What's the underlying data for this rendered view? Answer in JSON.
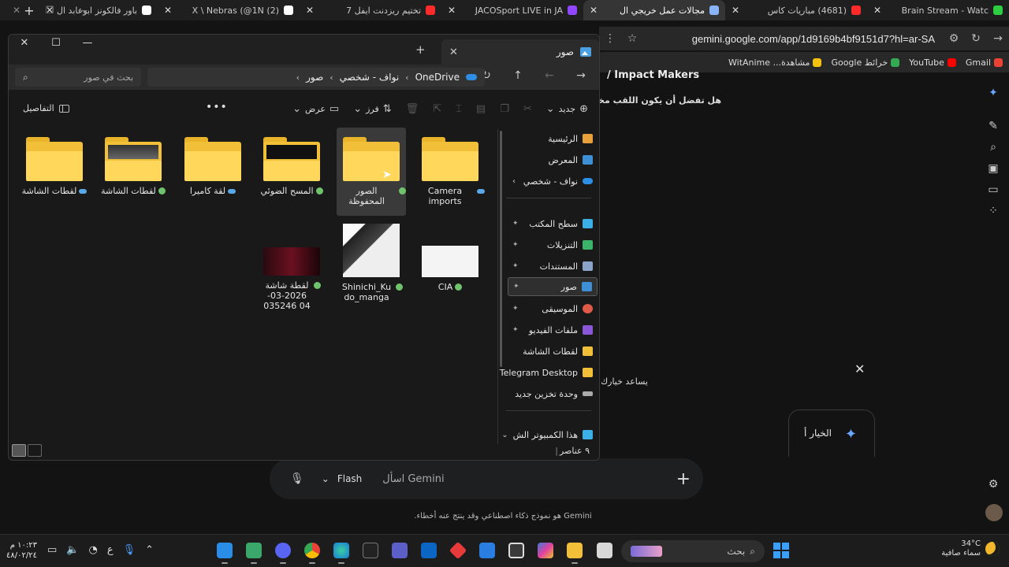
{
  "browser": {
    "tabs": [
      {
        "label": "Brain Stream - Watc",
        "icon_color": "#2ecc40"
      },
      {
        "label": "(4681) مباريات كاس",
        "icon_color": "#ff2b2b"
      },
      {
        "label": "مجالات عمل خريجي ال",
        "icon_color": "#8ab4f8",
        "active": true
      },
      {
        "label": "JACOSport LIVE in JA",
        "icon_color": "#9146ff"
      },
      {
        "label": "تختيم ريزدنت ايفل 7",
        "icon_color": "#ff2b2b"
      },
      {
        "label": "(2) X \\ Nebras (@1N",
        "icon_color": "#ffffff"
      },
      {
        "label": "باور فالكونز ابوعابد ال",
        "icon_color": "#ffffff"
      }
    ],
    "url": "gemini.google.com/app/1d9169b4bf9151d7?hl=ar-SA",
    "bookmarks": [
      {
        "label": "Gmail",
        "color": "#ea4335"
      },
      {
        "label": "YouTube",
        "color": "#ff0000"
      },
      {
        "label": "خرائط Google",
        "color": "#34a853"
      },
      {
        "label": "مشاهدة... WitAnime",
        "color": "#f4c20d"
      }
    ]
  },
  "gemini": {
    "heading": "/ Impact Makers",
    "question": "هل تفضل أن يكون اللقب مخصصاً",
    "hint": "يساعد خيارك",
    "option_label": "الخيار أ",
    "input_placeholder": "اسأل Gemini",
    "mode_label": "Flash",
    "disclaimer": "Gemini هو نموذج ذكاء اصطناعي وقد ينتج عنه أخطاء."
  },
  "explorer": {
    "tab_title": "صور",
    "breadcrumb": [
      "OneDrive",
      "نواف - شخصي",
      "صور"
    ],
    "search_placeholder": "بحث في صور",
    "toolbar": {
      "new": "جديد",
      "sort": "فرز",
      "view": "عرض",
      "details": "التفاصيل"
    },
    "sidebar": {
      "top": [
        {
          "label": "الرئيسية",
          "color": "#e9a23b"
        },
        {
          "label": "المعرض",
          "color": "#3d8fd6"
        },
        {
          "label": "نواف - شخصي",
          "color": "#2d8ee6",
          "expand": true
        }
      ],
      "pinned": [
        {
          "label": "سطح المكتب",
          "color": "#3ab0e6"
        },
        {
          "label": "التنزيلات",
          "color": "#3bb36b"
        },
        {
          "label": "المستندات",
          "color": "#8aa3c8"
        },
        {
          "label": "صور",
          "color": "#3d8fd6",
          "selected": true
        },
        {
          "label": "الموسيقى",
          "color": "#e05a4a"
        },
        {
          "label": "ملفات الفيديو",
          "color": "#8a57d6"
        },
        {
          "label": "لقطات الشاشة",
          "color": "#f2c038"
        },
        {
          "label": "Telegram Desktop",
          "color": "#f2c038"
        },
        {
          "label": "وحدة تخزين جديد",
          "color": "#aaaaaa"
        }
      ],
      "this_pc": {
        "label": "هذا الكمبيوتر الش",
        "color": "#3ab0e6"
      }
    },
    "items": [
      {
        "name": "Camera imports",
        "kind": "folder",
        "status": "cloud"
      },
      {
        "name": "الصور المحفوظة",
        "kind": "folder",
        "status": "synced",
        "selected": true
      },
      {
        "name": "المسح الضوئي",
        "kind": "folder",
        "status": "synced",
        "paper": "black"
      },
      {
        "name": "لقة كاميرا",
        "kind": "folder",
        "status": "cloud"
      },
      {
        "name": "لقطات الشاشة",
        "kind": "folder",
        "status": "synced",
        "paper": "dark"
      },
      {
        "name": "لقطات الشاشة",
        "kind": "folder",
        "status": "cloud"
      },
      {
        "name": "CIA",
        "kind": "image",
        "status": "synced"
      },
      {
        "name": "Shinichi_Kudo_manga",
        "kind": "image",
        "status": "synced"
      },
      {
        "name": "لقطة شاشة 2026-03-04 035246",
        "kind": "image",
        "status": "synced"
      }
    ],
    "status_count": "٩ عناصر"
  },
  "taskbar": {
    "weather_temp": "34°C",
    "weather_desc": "سماء صافية",
    "search_label": "بحث",
    "clock_time": "١٠:٢٣ م",
    "clock_date": "٤٨/٠٢/٢٤",
    "lang": "ع"
  }
}
